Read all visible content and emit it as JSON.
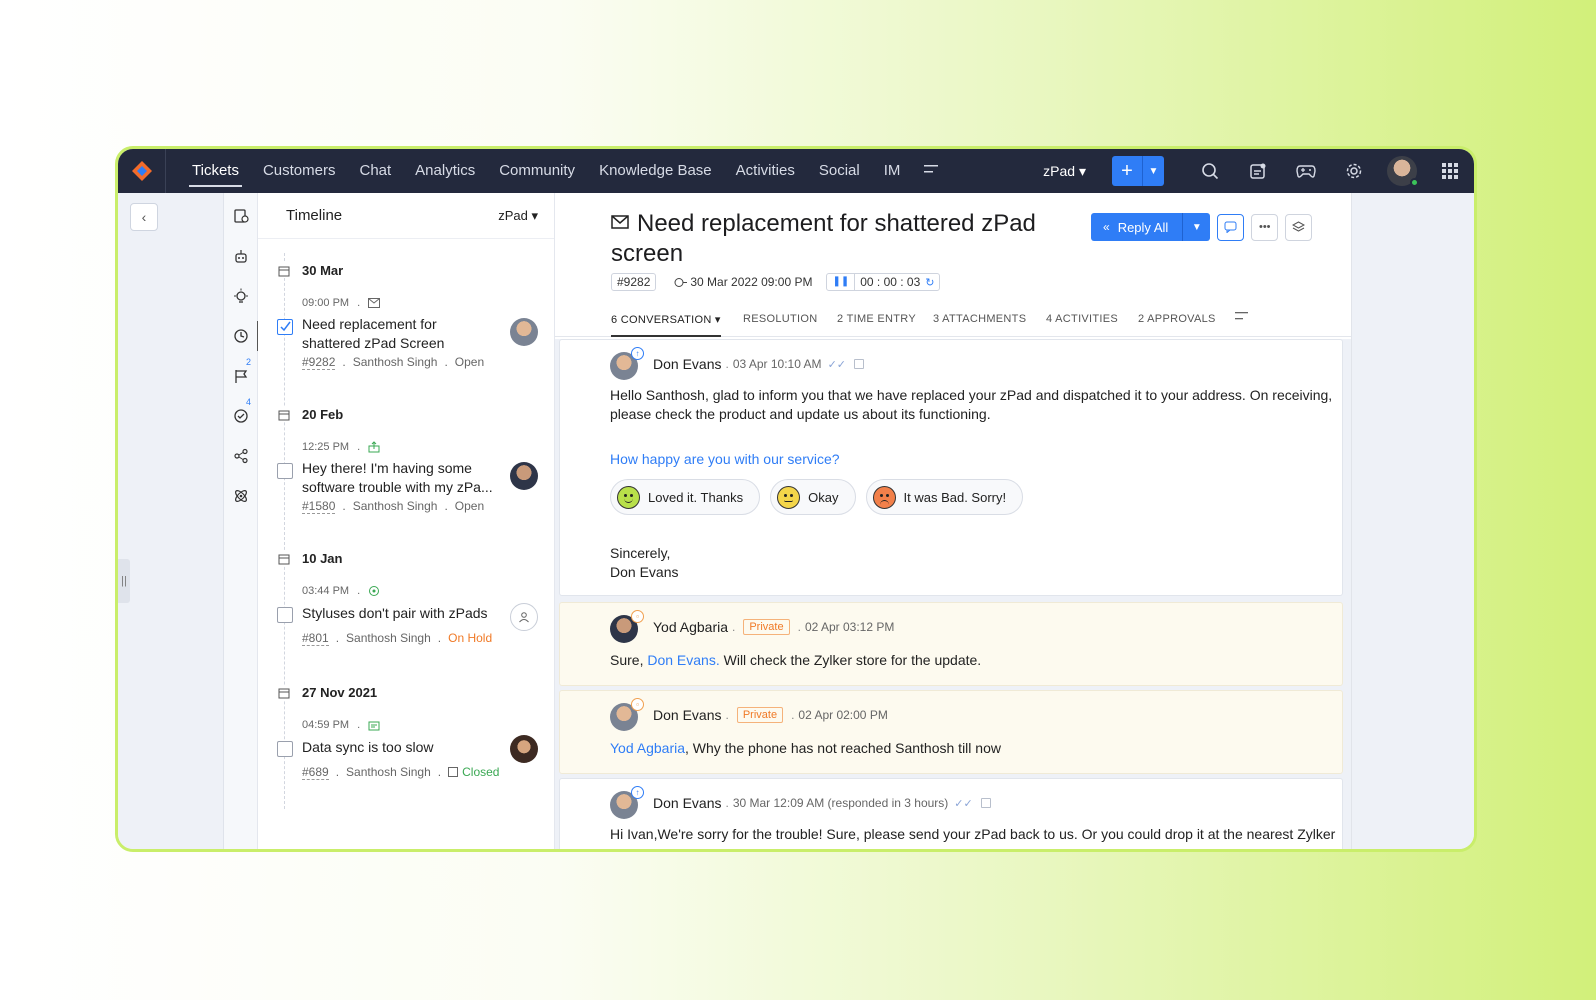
{
  "nav": {
    "tabs": [
      "Tickets",
      "Customers",
      "Chat",
      "Analytics",
      "Community",
      "Knowledge Base",
      "Activities",
      "Social",
      "IM"
    ],
    "more_icon": "menu-lines-icon",
    "department": "zPad ▾",
    "add_label": "+"
  },
  "timeline": {
    "title": "Timeline",
    "department": "zPad ▾",
    "groups": [
      {
        "date": "30 Mar",
        "time": "09:00 PM",
        "channel_icon": "mail-icon",
        "subject_line1": "Need replacement for",
        "subject_line2": "shattered zPad Screen",
        "number": "#9282",
        "agent": "Santhosh Singh",
        "status": "Open"
      },
      {
        "date": "20 Feb",
        "time": "12:25 PM",
        "channel_icon": "web-icon",
        "subject_line1": "Hey there! I'm having some",
        "subject_line2": "software trouble with my zPa...",
        "number": "#1580",
        "agent": "Santhosh Singh",
        "status": "Open"
      },
      {
        "date": "10 Jan",
        "time": "03:44 PM",
        "channel_icon": "chat-icon",
        "subject_line1": "Styluses don't pair with zPads",
        "subject_line2": "",
        "number": "#801",
        "agent": "Santhosh Singh",
        "status": "On Hold"
      },
      {
        "date": "27 Nov 2021",
        "time": "04:59 PM",
        "channel_icon": "forum-icon",
        "subject_line1": "Data sync is too slow",
        "subject_line2": "",
        "number": "#689",
        "agent": "Santhosh Singh",
        "status": "Closed"
      }
    ]
  },
  "ticket": {
    "title_line1": "Need replacement for shattered zPad",
    "title_line2": "screen",
    "number": "#9282",
    "created": "30 Mar 2022 09:00 PM",
    "timer": "00 : 00 : 03",
    "reply_all": "Reply All"
  },
  "tabs": [
    "6 CONVERSATION ▾",
    "RESOLUTION",
    "2 TIME ENTRY",
    "3 ATTACHMENTS",
    "4 ACTIVITIES",
    "2 APPROVALS"
  ],
  "threads": {
    "t1": {
      "name": "Don Evans",
      "time": "03 Apr 10:10 AM",
      "body_line1": "Hello Santhosh, glad to inform you that we have replaced your zPad and dispatched it to your address. On receiving,",
      "body_line2": "please check the product and update us about its functioning.",
      "question": "How happy are you with our service?",
      "feedback": [
        "Loved it. Thanks",
        "Okay",
        "It was Bad. Sorry!"
      ],
      "sign1": "Sincerely,",
      "sign2": "Don Evans"
    },
    "t2": {
      "name": "Yod Agbaria",
      "badge": "Private",
      "time": "02 Apr 03:12 PM",
      "body_pre": "Sure, ",
      "body_link": "Don Evans.",
      "body_post": " Will check the Zylker store for the update."
    },
    "t3": {
      "name": "Don Evans",
      "badge": "Private",
      "time": "02 Apr 02:00 PM",
      "body_link": "Yod Agbaria",
      "body_post": ",  Why the phone has not reached Santhosh till now"
    },
    "t4": {
      "name": "Don Evans",
      "time": "30 Mar 12:09 AM (responded in 3 hours)",
      "body": "Hi Ivan,We're sorry for the trouble! Sure, please send your zPad back to us. Or you could drop it at the nearest Zylker"
    }
  },
  "colors": {
    "nav_bg": "#23293d",
    "accent": "#2f7df6",
    "private": "#f07a27",
    "closed": "#3aa853",
    "frame_border": "#c9ee6a"
  }
}
